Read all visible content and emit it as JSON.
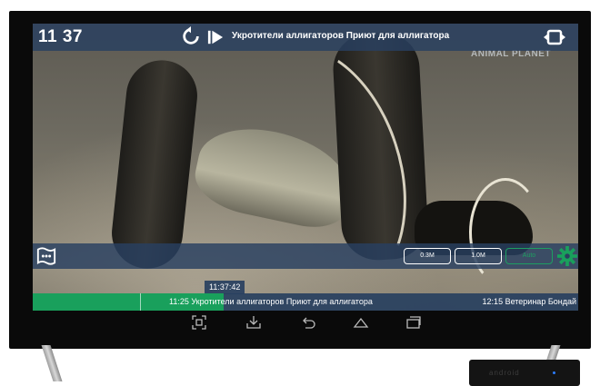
{
  "player": {
    "clock": "11 37",
    "now_title": "Укротители аллигаторов Приют для аллигатора",
    "watermark": "ANIMAL PLANET"
  },
  "quality": {
    "options": [
      {
        "label": "0.3M",
        "selected": false
      },
      {
        "label": "1.0M",
        "selected": false
      },
      {
        "label": "Auto",
        "selected": true
      }
    ],
    "accent_color": "#19a05c"
  },
  "timeline": {
    "current_time": "11:37:42",
    "progress_percent": 35,
    "current_program": "11:25 Укротители аллигаторов Приют для аллигатора",
    "next_program": "12:15 Ветеринар Бондай"
  },
  "icons": {
    "reload": "reload-icon",
    "play": "play-icon",
    "fullscreen": "fullscreen-icon",
    "menu": "chat-menu-icon",
    "settings": "gear-icon"
  },
  "navbar": {
    "buttons": [
      "screenshot-icon",
      "download-icon",
      "back-icon",
      "home-icon",
      "recents-icon"
    ]
  },
  "device": {
    "box_label": "android"
  }
}
